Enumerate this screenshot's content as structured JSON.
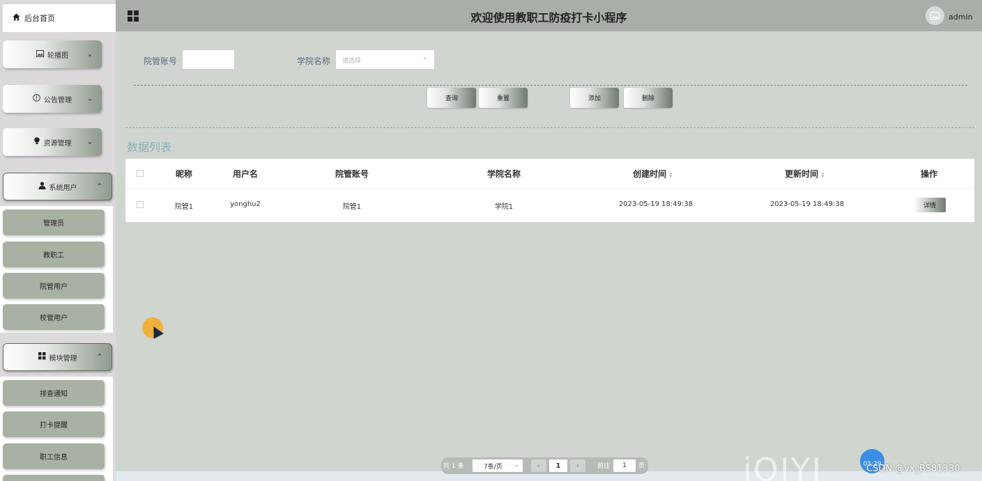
{
  "sidebar": {
    "home": "后台首页",
    "menus": [
      {
        "label": "轮播图"
      },
      {
        "label": "公告管理"
      },
      {
        "label": "资源管理"
      },
      {
        "label": "系统用户"
      },
      {
        "label": "模块管理"
      }
    ],
    "system_users": [
      "管理员",
      "教职工",
      "院管用户",
      "校管用户"
    ],
    "modules": [
      "排查通知",
      "打卡提醒",
      "职工信息"
    ]
  },
  "header": {
    "title": "欢迎使用教职工防疫打卡小程序",
    "user": "admin"
  },
  "search": {
    "field1_label": "院管账号",
    "field2_label": "学院名称",
    "select_placeholder": "请选择",
    "buttons": {
      "query": "查询",
      "reset": "重置",
      "add": "添加",
      "delete": "删除"
    }
  },
  "list": {
    "title": "数据列表",
    "columns": [
      "昵称",
      "用户名",
      "院管账号",
      "学院名称",
      "创建时间",
      "更新时间",
      "操作"
    ],
    "rows": [
      {
        "nickname": "院管1",
        "username": "yonghu2",
        "account": "院管1",
        "college": "学院1",
        "created": "2023-05-19 18:49:38",
        "updated": "2023-05-19 18:49:38",
        "action": "详情"
      }
    ]
  },
  "pagination": {
    "total": "共 1 条",
    "page_size": "7条/页",
    "prev": "‹",
    "current": "1",
    "next": "›",
    "goto": "前往",
    "jump_value": "1",
    "page_suffix": "页"
  },
  "overlay": {
    "iqiyi": "iQIYI",
    "timer": "03:29",
    "watermark": "CSDN @vx_BS81330"
  }
}
